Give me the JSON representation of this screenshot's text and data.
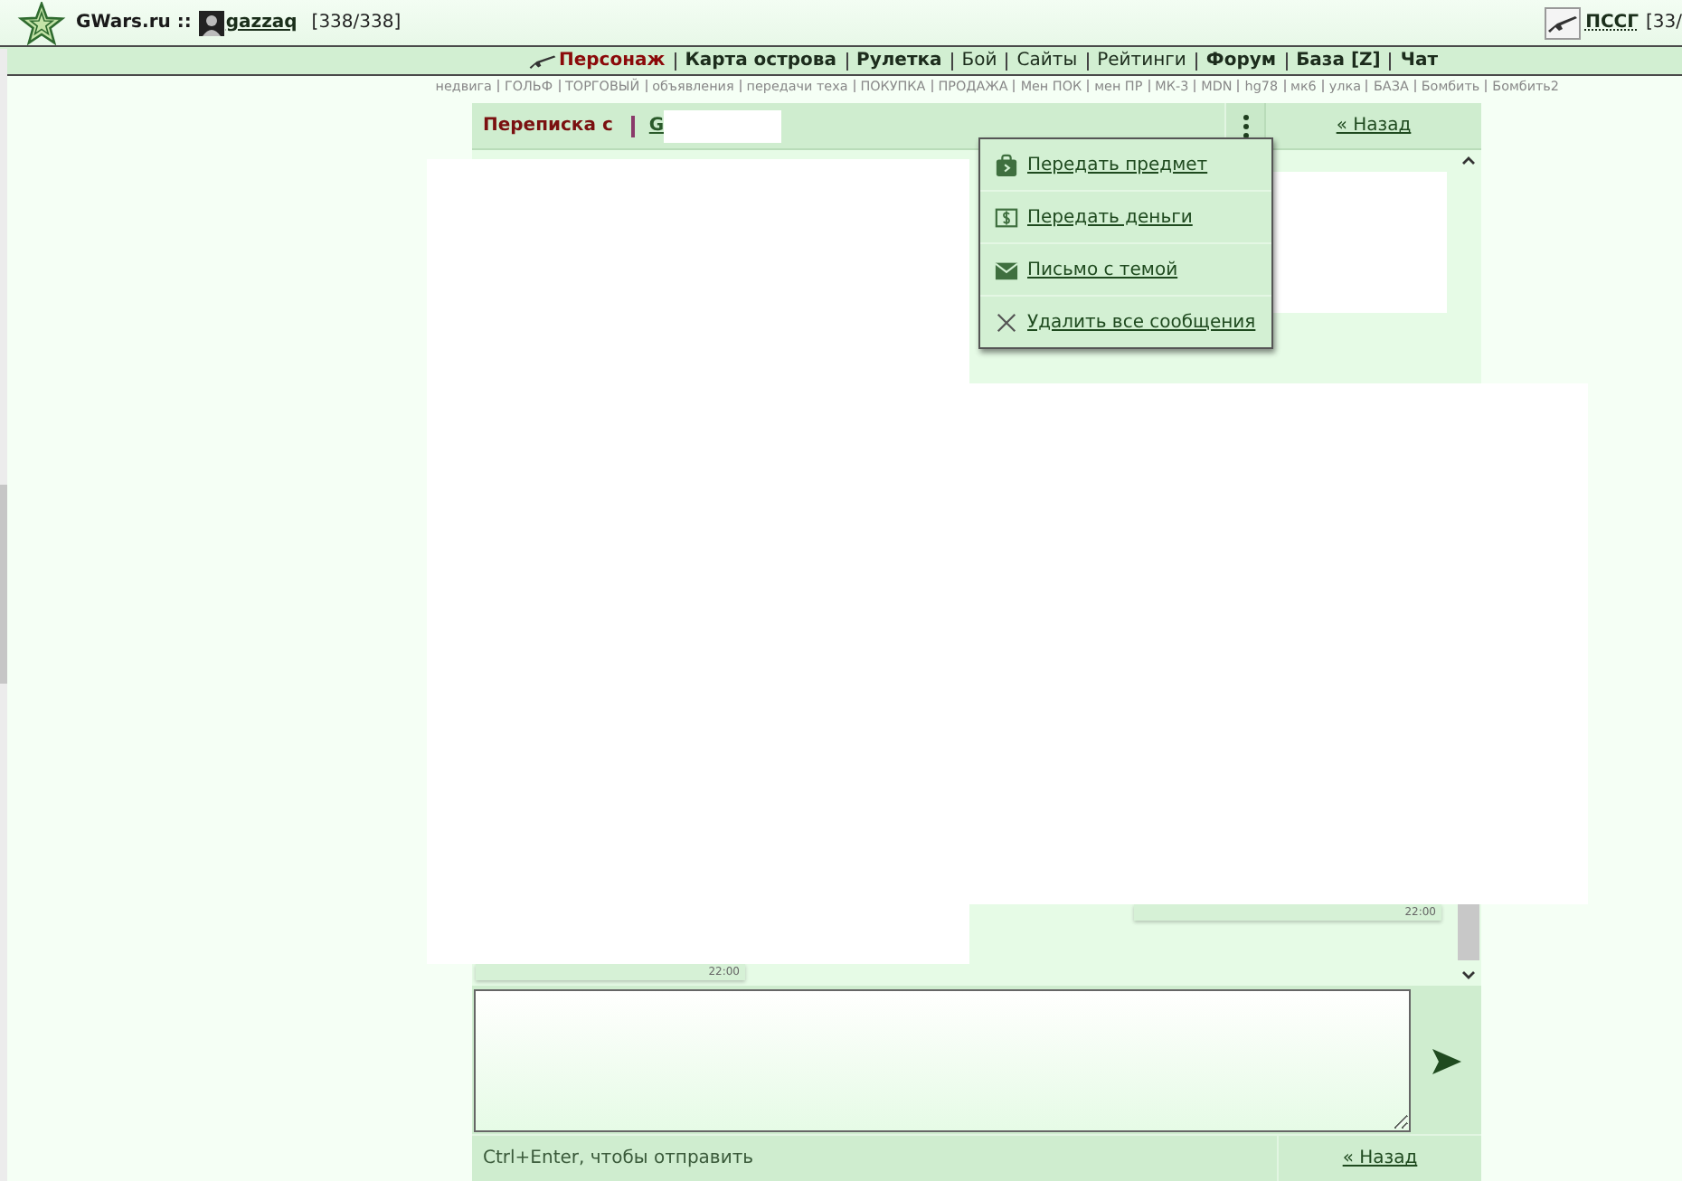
{
  "top_bar": {
    "site": "GWars.ru ::",
    "user": {
      "name": "gazzaq",
      "hp": "[338/338]"
    },
    "syndicate": {
      "name": "ПССГ",
      "count": "[33/"
    }
  },
  "nav": [
    {
      "label": "Персонаж",
      "selected": true,
      "bold": true
    },
    {
      "label": "Карта острова",
      "selected": false,
      "bold": true
    },
    {
      "label": "Рулетка",
      "selected": false,
      "bold": true
    },
    {
      "label": "Бой",
      "selected": false,
      "bold": false
    },
    {
      "label": "Сайты",
      "selected": false,
      "bold": false
    },
    {
      "label": "Рейтинги",
      "selected": false,
      "bold": false
    },
    {
      "label": "Форум",
      "selected": false,
      "bold": true
    },
    {
      "label": "База [Z]",
      "selected": false,
      "bold": true
    },
    {
      "label": "Чат",
      "selected": false,
      "bold": true
    }
  ],
  "quick_links": [
    "недвига",
    "ГОЛЬФ",
    "ТОРГОВЫЙ",
    "объявления",
    "передачи теха",
    "ПОКУПКА",
    "ПРОДАЖА",
    "Мен ПОК",
    "мен ПР",
    "МК-3",
    "MDN",
    "hg78",
    "мк6",
    "улка",
    "БАЗА",
    "Бомбить",
    "Бомбить2"
  ],
  "chat": {
    "title": "Переписка с",
    "partner": "G",
    "back": "« Назад",
    "menu": {
      "open": true,
      "items": [
        {
          "kind": "item",
          "label": "Передать предмет"
        },
        {
          "kind": "money",
          "label": "Передать деньги"
        },
        {
          "kind": "letter",
          "label": "Письмо с темой"
        },
        {
          "kind": "delete",
          "label": "Удалить все сообщения"
        }
      ]
    },
    "messages": [
      {
        "outgoing": true,
        "time": "22:00"
      },
      {
        "outgoing": false,
        "time": "22:00"
      }
    ]
  },
  "composer": {
    "note": "Ctrl+Enter, чтобы отправить",
    "back": "« Назад"
  }
}
